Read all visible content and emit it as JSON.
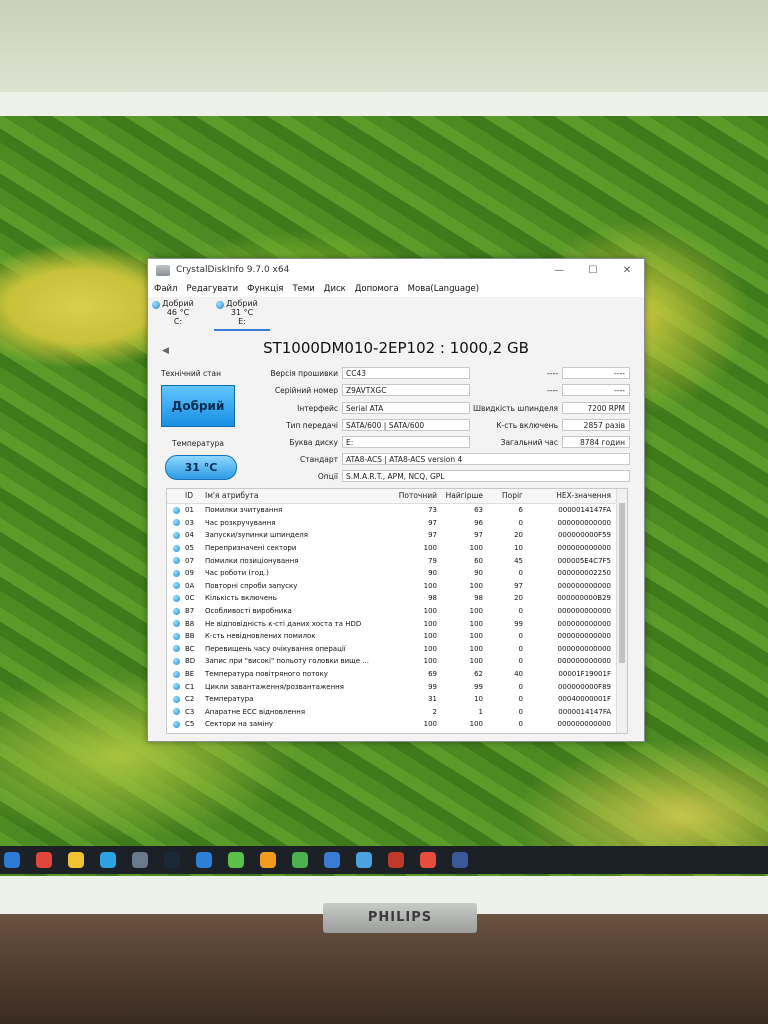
{
  "window": {
    "title": "CrystalDiskInfo 9.7.0 x64",
    "controls": {
      "min": "—",
      "max": "☐",
      "close": "✕"
    }
  },
  "menu": [
    "Файл",
    "Редагувати",
    "Функція",
    "Теми",
    "Диск",
    "Допомога",
    "Мова(Language)"
  ],
  "disk_tabs": [
    {
      "status": "Добрий",
      "temp": "46 °C",
      "letter": "C:"
    },
    {
      "status": "Добрий",
      "temp": "31 °C",
      "letter": "E:"
    }
  ],
  "drive": {
    "model": "ST1000DM010-2EP102 : 1000,2 GB",
    "health_label": "Технічний стан",
    "health_value": "Добрий",
    "temp_label": "Температура",
    "temp_value": "31 °C",
    "fields": {
      "firmware_label": "Версія прошивки",
      "firmware": "CC43",
      "serial_label": "Серійний номер",
      "serial": "Z9AVTXGC",
      "interface_label": "Інтерфейс",
      "interface": "Serial ATA",
      "transfer_label": "Тип передачі",
      "transfer": "SATA/600 | SATA/600",
      "letter_label": "Буква диску",
      "letter": "E:",
      "standard_label": "Стандарт",
      "standard": "ATA8-ACS | ATA8-ACS version 4",
      "features_label": "Опції",
      "features": "S.M.A.R.T., APM, NCQ, GPL",
      "blank_a_label": "----",
      "blank_a": "----",
      "blank_b_label": "----",
      "blank_b": "----",
      "rpm_label": "Швидкість шпинделя",
      "rpm": "7200 RPM",
      "power_on_count_label": "К-сть включень",
      "power_on_count": "2857 разів",
      "power_on_hours_label": "Загальний час",
      "power_on_hours": "8784 годин"
    }
  },
  "smart": {
    "headers": {
      "id": "ID",
      "name": "Ім'я атрибута",
      "current": "Поточний",
      "worst": "Найгірше",
      "threshold": "Поріг",
      "raw": "HEX-значення"
    },
    "rows": [
      {
        "id": "01",
        "name": "Помилки зчитування",
        "current": "73",
        "worst": "63",
        "threshold": "6",
        "raw": "0000014147FA"
      },
      {
        "id": "03",
        "name": "Час розкручування",
        "current": "97",
        "worst": "96",
        "threshold": "0",
        "raw": "000000000000"
      },
      {
        "id": "04",
        "name": "Запуски/зупинки шпинделя",
        "current": "97",
        "worst": "97",
        "threshold": "20",
        "raw": "000000000F59"
      },
      {
        "id": "05",
        "name": "Перепризначені сектори",
        "current": "100",
        "worst": "100",
        "threshold": "10",
        "raw": "000000000000"
      },
      {
        "id": "07",
        "name": "Помилки позиціонування",
        "current": "79",
        "worst": "60",
        "threshold": "45",
        "raw": "000005E4C7F5"
      },
      {
        "id": "09",
        "name": "Час роботи (год.)",
        "current": "90",
        "worst": "90",
        "threshold": "0",
        "raw": "000000002250"
      },
      {
        "id": "0A",
        "name": "Повторні спроби запуску",
        "current": "100",
        "worst": "100",
        "threshold": "97",
        "raw": "000000000000"
      },
      {
        "id": "0C",
        "name": "Кількість включень",
        "current": "98",
        "worst": "98",
        "threshold": "20",
        "raw": "000000000B29"
      },
      {
        "id": "B7",
        "name": "Особливості виробника",
        "current": "100",
        "worst": "100",
        "threshold": "0",
        "raw": "000000000000"
      },
      {
        "id": "B8",
        "name": "Не відповідність к-сті даних хоста та HDD",
        "current": "100",
        "worst": "100",
        "threshold": "99",
        "raw": "000000000000"
      },
      {
        "id": "BB",
        "name": "К-сть невідновлених помилок",
        "current": "100",
        "worst": "100",
        "threshold": "0",
        "raw": "000000000000"
      },
      {
        "id": "BC",
        "name": "Перевищень часу очікування операції",
        "current": "100",
        "worst": "100",
        "threshold": "0",
        "raw": "000000000000"
      },
      {
        "id": "BD",
        "name": "Запис при \"високі\" польоту головки вище ...",
        "current": "100",
        "worst": "100",
        "threshold": "0",
        "raw": "000000000000"
      },
      {
        "id": "BE",
        "name": "Температура повітряного потоку",
        "current": "69",
        "worst": "62",
        "threshold": "40",
        "raw": "00001F19001F"
      },
      {
        "id": "C1",
        "name": "Цикли завантаження/розвантаження",
        "current": "99",
        "worst": "99",
        "threshold": "0",
        "raw": "000000000F89"
      },
      {
        "id": "C2",
        "name": "Температура",
        "current": "31",
        "worst": "10",
        "threshold": "0",
        "raw": "00040000001F"
      },
      {
        "id": "C3",
        "name": "Апаратне ECC відновлення",
        "current": "2",
        "worst": "1",
        "threshold": "0",
        "raw": "0000014147FA"
      },
      {
        "id": "C5",
        "name": "Сектори на заміну",
        "current": "100",
        "worst": "100",
        "threshold": "0",
        "raw": "000000000000"
      }
    ]
  },
  "monitor_brand": "PHILIPS",
  "taskbar_icon_colors": [
    "#2e7bd6",
    "#e2453c",
    "#f2c230",
    "#2aa3e0",
    "#6b7a8c",
    "#1b2838",
    "#2b7fd4",
    "#5bbf4a",
    "#f29c1f",
    "#4caf50",
    "#3a7bd5",
    "#4aa3df",
    "#c0392b",
    "#e74c3c",
    "#3b5998"
  ]
}
